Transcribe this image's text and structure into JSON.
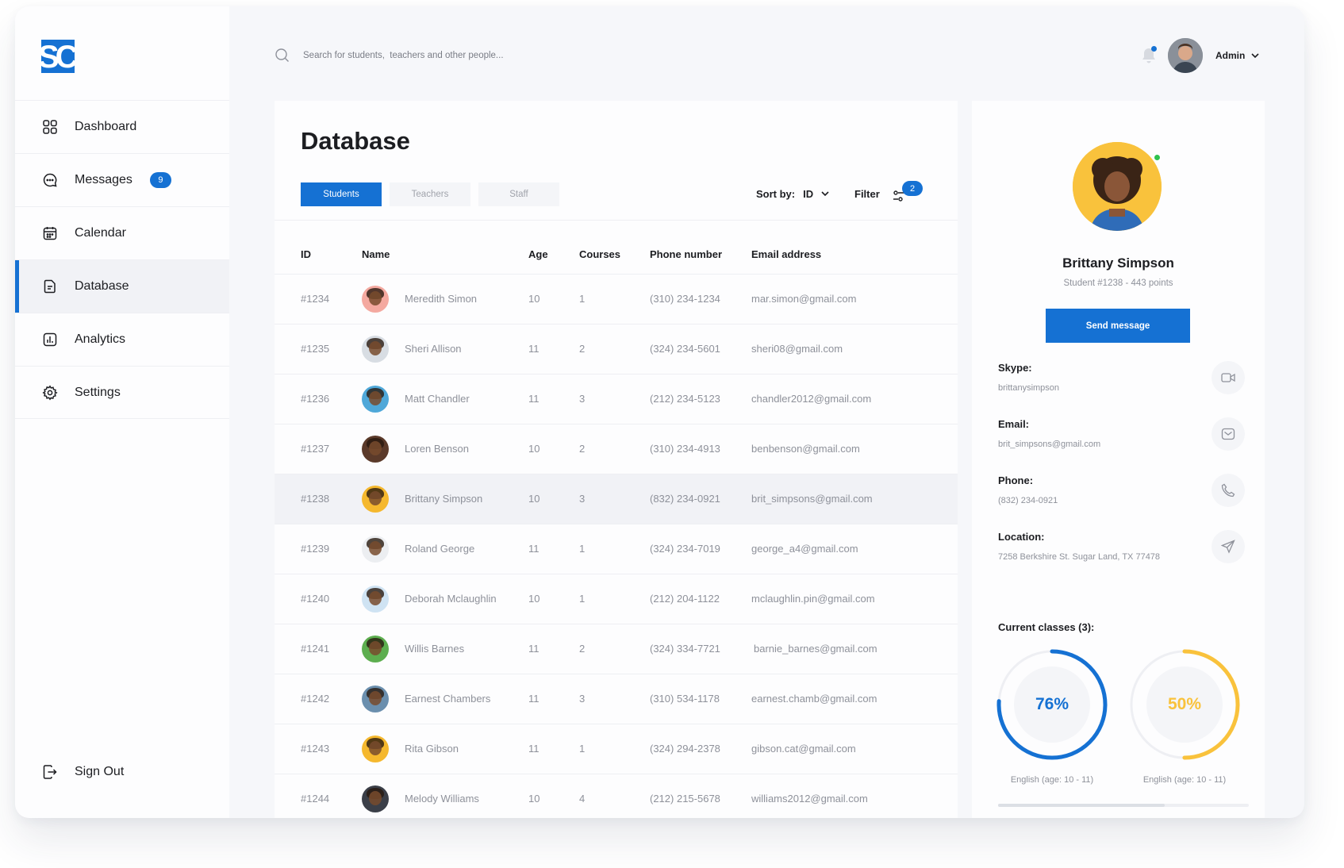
{
  "app": {
    "logo_text": "SC"
  },
  "sidebar": {
    "items": [
      {
        "label": "Dashboard",
        "icon": "grid-icon"
      },
      {
        "label": "Messages",
        "icon": "chat-icon",
        "badge": "9"
      },
      {
        "label": "Calendar",
        "icon": "calendar-icon"
      },
      {
        "label": "Database",
        "icon": "document-icon",
        "active": true
      },
      {
        "label": "Analytics",
        "icon": "chart-icon"
      },
      {
        "label": "Settings",
        "icon": "gear-icon"
      }
    ],
    "signout_label": "Sign Out"
  },
  "topbar": {
    "search_placeholder": "Search for students,  teachers and other people...",
    "user_label": "Admin"
  },
  "main": {
    "title": "Database",
    "tabs": [
      {
        "label": "Students",
        "active": true
      },
      {
        "label": "Teachers"
      },
      {
        "label": "Staff"
      }
    ],
    "sort_label": "Sort by:",
    "sort_value": "ID",
    "filter_label": "Filter",
    "filter_count": "2",
    "columns": [
      "ID",
      "Name",
      "Age",
      "Courses",
      "Phone number",
      "Email address"
    ],
    "rows": [
      {
        "id": "#1234",
        "name": "Meredith Simon",
        "age": "10",
        "courses": "1",
        "phone": "(310) 234-1234",
        "email": "mar.simon@gmail.com",
        "avatar_color": "#f4a9a0"
      },
      {
        "id": "#1235",
        "name": "Sheri Allison",
        "age": "11",
        "courses": "2",
        "phone": "(324) 234-5601",
        "email": "sheri08@gmail.com",
        "avatar_color": "#d8dde3"
      },
      {
        "id": "#1236",
        "name": "Matt Chandler",
        "age": "11",
        "courses": "3",
        "phone": "(212) 234-5123",
        "email": "chandler2012@gmail.com",
        "avatar_color": "#4fa8d9"
      },
      {
        "id": "#1237",
        "name": "Loren Benson",
        "age": "10",
        "courses": "2",
        "phone": "(310) 234-4913",
        "email": "benbenson@gmail.com",
        "avatar_color": "#5b3a2a"
      },
      {
        "id": "#1238",
        "name": "Brittany Simpson",
        "age": "10",
        "courses": "3",
        "phone": "(832) 234-0921",
        "email": "brit_simpsons@gmail.com",
        "avatar_color": "#f5b82e",
        "selected": true
      },
      {
        "id": "#1239",
        "name": "Roland George",
        "age": "11",
        "courses": "1",
        "phone": "(324) 234-7019",
        "email": "george_a4@gmail.com",
        "avatar_color": "#eceef1"
      },
      {
        "id": "#1240",
        "name": "Deborah Mclaughlin",
        "age": "10",
        "courses": "1",
        "phone": "(212) 204-1122",
        "email": "mclaughlin.pin@gmail.com",
        "avatar_color": "#cfe3f3"
      },
      {
        "id": "#1241",
        "name": "Willis Barnes",
        "age": "11",
        "courses": "2",
        "phone": "(324) 334-7721",
        "email": "barnie_barnes@gmail.com",
        "avatar_color": "#5dae4f"
      },
      {
        "id": "#1242",
        "name": "Earnest Chambers",
        "age": "11",
        "courses": "3",
        "phone": "(310) 534-1178",
        "email": "earnest.chamb@gmail.com",
        "avatar_color": "#6b8fae"
      },
      {
        "id": "#1243",
        "name": "Rita Gibson",
        "age": "11",
        "courses": "1",
        "phone": "(324) 294-2378",
        "email": "gibson.cat@gmail.com",
        "avatar_color": "#f5b82e"
      },
      {
        "id": "#1244",
        "name": "Melody Williams",
        "age": "10",
        "courses": "4",
        "phone": "(212) 215-5678",
        "email": "williams2012@gmail.com",
        "avatar_color": "#3b3f48"
      }
    ]
  },
  "profile": {
    "name": "Brittany Simpson",
    "subtitle": "Student #1238 - 443 points",
    "send_label": "Send message",
    "skype_label": "Skype:",
    "skype_value": "brittanysimpson",
    "email_label": "Email:",
    "email_value": "brit_simpsons@gmail.com",
    "phone_label": "Phone:",
    "phone_value": "(832) 234-0921",
    "location_label": "Location:",
    "location_value": "7258 Berkshire St. Sugar Land, TX 77478",
    "classes_label": "Current classes (3):",
    "classes": [
      {
        "value_text": "76%",
        "percent": 76,
        "caption": "English (age: 10 - 11)",
        "color": "#1571d3"
      },
      {
        "value_text": "50%",
        "percent": 50,
        "caption": "English (age: 10 - 11)",
        "color": "#f9c23c"
      }
    ]
  },
  "colors": {
    "accent": "#1571d3",
    "online": "#2ec24f",
    "yellow": "#f9c23c"
  }
}
